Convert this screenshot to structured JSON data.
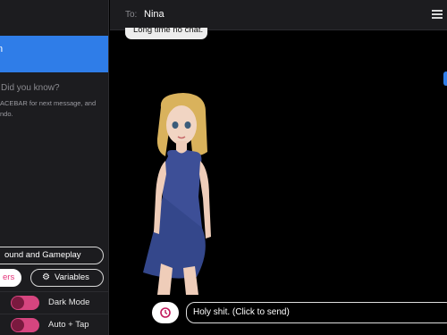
{
  "sidebar": {
    "did_you_know": "Did you know?",
    "tip_line1": "ACEBAR for next message, and",
    "tip_line2": "ndo.",
    "buttons": {
      "sound_gameplay": "ound and Gameplay",
      "users": "ers",
      "variables": "Variables"
    },
    "toggles": [
      {
        "label": "Dark Mode",
        "on": true
      },
      {
        "label": "Auto + Tap",
        "on": true
      }
    ]
  },
  "header": {
    "to_label": "To:",
    "recipient": "Nina"
  },
  "chat": {
    "messages": [
      {
        "text": "Long time no chat."
      }
    ]
  },
  "composer": {
    "message": "Holy shit. (Click to send)"
  },
  "colors": {
    "accent": "#2f7de8",
    "toggle": "#d6457f",
    "background": "#000000"
  }
}
